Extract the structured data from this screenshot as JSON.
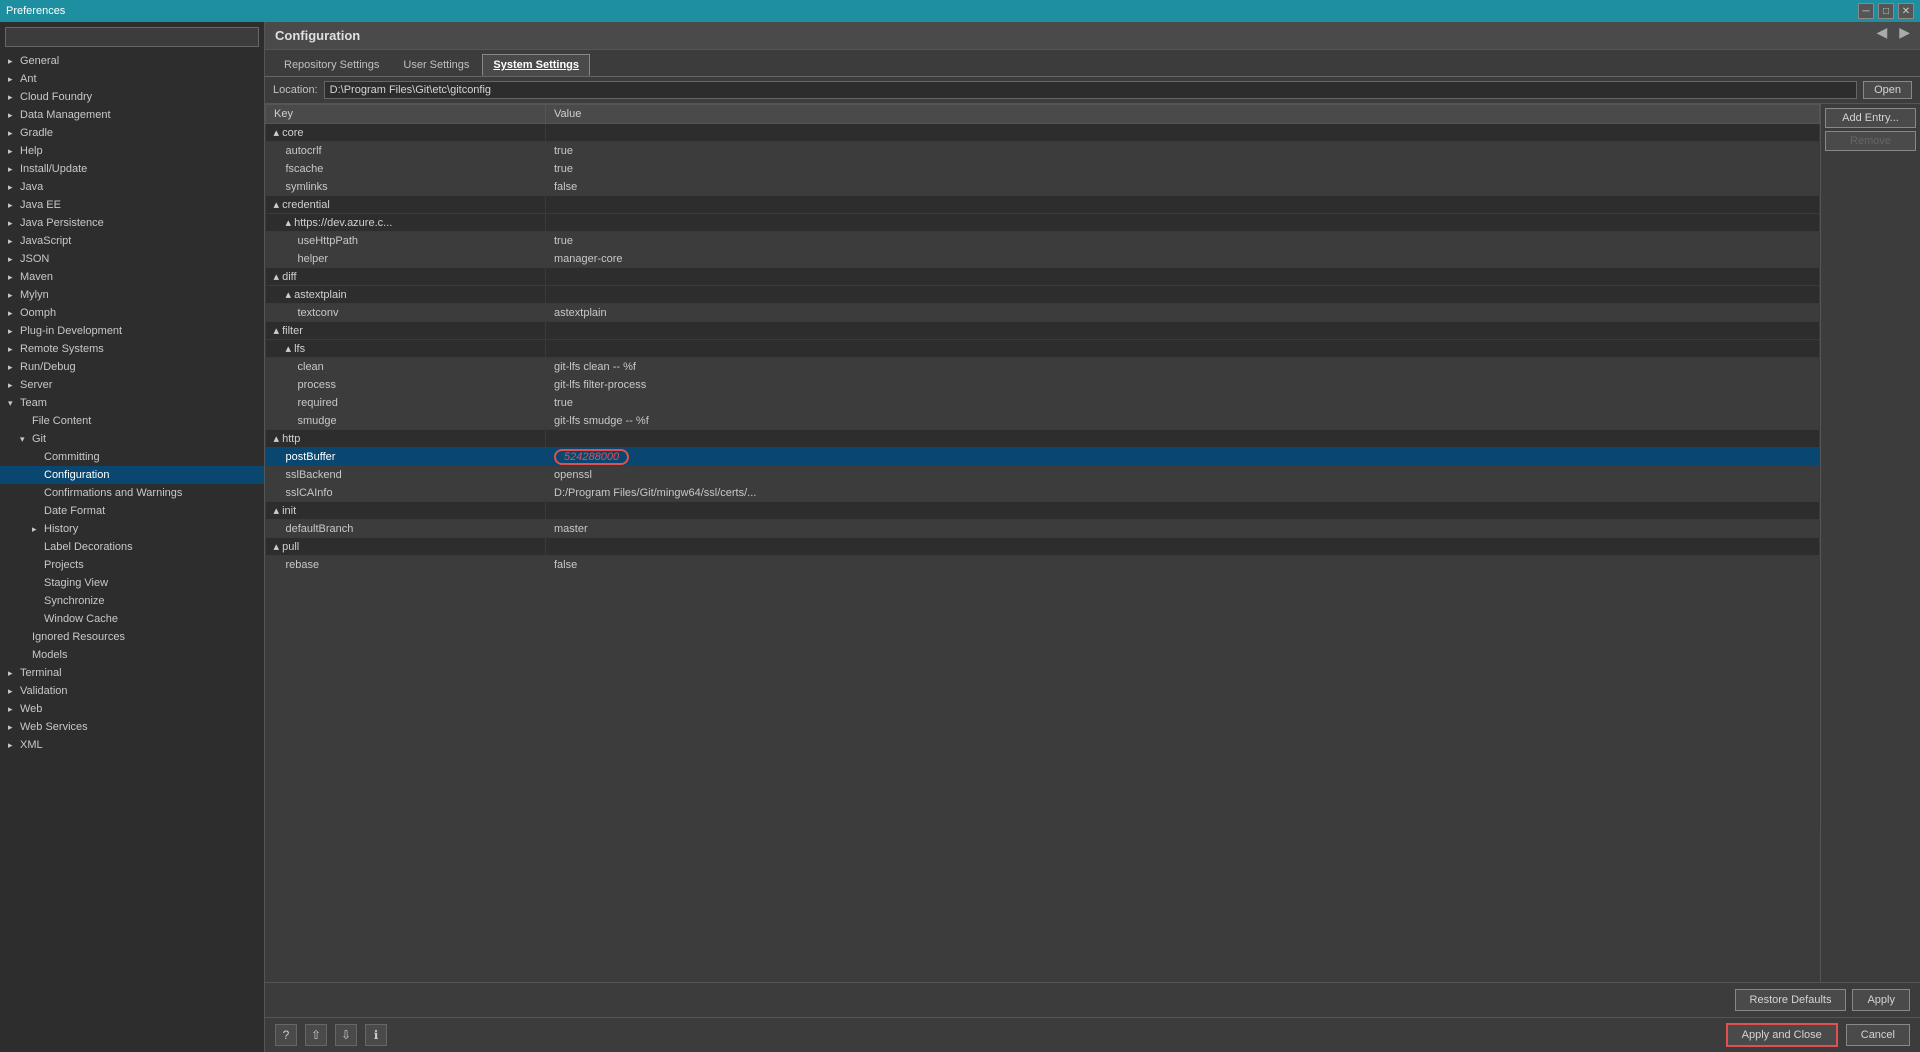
{
  "titleBar": {
    "title": "Preferences",
    "buttons": [
      "minimize",
      "maximize",
      "close"
    ]
  },
  "sidebar": {
    "searchPlaceholder": "",
    "items": [
      {
        "id": "general",
        "label": "General",
        "indent": 0,
        "expanded": false,
        "selected": false
      },
      {
        "id": "ant",
        "label": "Ant",
        "indent": 0,
        "expanded": false,
        "selected": false
      },
      {
        "id": "cloudFoundry",
        "label": "Cloud Foundry",
        "indent": 0,
        "expanded": false,
        "selected": false
      },
      {
        "id": "dataManagement",
        "label": "Data Management",
        "indent": 0,
        "expanded": false,
        "selected": false
      },
      {
        "id": "gradle",
        "label": "Gradle",
        "indent": 0,
        "expanded": false,
        "selected": false
      },
      {
        "id": "help",
        "label": "Help",
        "indent": 0,
        "expanded": false,
        "selected": false
      },
      {
        "id": "installUpdate",
        "label": "Install/Update",
        "indent": 0,
        "expanded": false,
        "selected": false
      },
      {
        "id": "java",
        "label": "Java",
        "indent": 0,
        "expanded": false,
        "selected": false
      },
      {
        "id": "javaEE",
        "label": "Java EE",
        "indent": 0,
        "expanded": false,
        "selected": false
      },
      {
        "id": "javaPersistence",
        "label": "Java Persistence",
        "indent": 0,
        "expanded": false,
        "selected": false
      },
      {
        "id": "javaScript",
        "label": "JavaScript",
        "indent": 0,
        "expanded": false,
        "selected": false
      },
      {
        "id": "json",
        "label": "JSON",
        "indent": 0,
        "expanded": false,
        "selected": false
      },
      {
        "id": "maven",
        "label": "Maven",
        "indent": 0,
        "expanded": false,
        "selected": false
      },
      {
        "id": "mylyn",
        "label": "Mylyn",
        "indent": 0,
        "expanded": false,
        "selected": false
      },
      {
        "id": "oomph",
        "label": "Oomph",
        "indent": 0,
        "expanded": false,
        "selected": false
      },
      {
        "id": "pluginDev",
        "label": "Plug-in Development",
        "indent": 0,
        "expanded": false,
        "selected": false
      },
      {
        "id": "remoteSystems",
        "label": "Remote Systems",
        "indent": 0,
        "expanded": false,
        "selected": false
      },
      {
        "id": "runDebug",
        "label": "Run/Debug",
        "indent": 0,
        "expanded": false,
        "selected": false
      },
      {
        "id": "server",
        "label": "Server",
        "indent": 0,
        "expanded": false,
        "selected": false
      },
      {
        "id": "team",
        "label": "Team",
        "indent": 0,
        "expanded": true,
        "selected": false
      },
      {
        "id": "fileContent",
        "label": "File Content",
        "indent": 1,
        "expanded": false,
        "selected": false
      },
      {
        "id": "git",
        "label": "Git",
        "indent": 1,
        "expanded": true,
        "selected": false
      },
      {
        "id": "committing",
        "label": "Committing",
        "indent": 2,
        "expanded": false,
        "selected": false
      },
      {
        "id": "configuration",
        "label": "Configuration",
        "indent": 2,
        "expanded": false,
        "selected": true
      },
      {
        "id": "confirmationsWarnings",
        "label": "Confirmations and Warnings",
        "indent": 2,
        "expanded": false,
        "selected": false
      },
      {
        "id": "dateFormat",
        "label": "Date Format",
        "indent": 2,
        "expanded": false,
        "selected": false
      },
      {
        "id": "history",
        "label": "History",
        "indent": 2,
        "expanded": false,
        "selected": false
      },
      {
        "id": "labelDecorations",
        "label": "Label Decorations",
        "indent": 2,
        "expanded": false,
        "selected": false
      },
      {
        "id": "projects",
        "label": "Projects",
        "indent": 2,
        "expanded": false,
        "selected": false
      },
      {
        "id": "stagingView",
        "label": "Staging View",
        "indent": 2,
        "expanded": false,
        "selected": false
      },
      {
        "id": "synchronize",
        "label": "Synchronize",
        "indent": 2,
        "expanded": false,
        "selected": false
      },
      {
        "id": "windowCache",
        "label": "Window Cache",
        "indent": 2,
        "expanded": false,
        "selected": false
      },
      {
        "id": "ignoredResources",
        "label": "Ignored Resources",
        "indent": 1,
        "expanded": false,
        "selected": false
      },
      {
        "id": "models",
        "label": "Models",
        "indent": 1,
        "expanded": false,
        "selected": false
      },
      {
        "id": "terminal",
        "label": "Terminal",
        "indent": 0,
        "expanded": false,
        "selected": false
      },
      {
        "id": "validation",
        "label": "Validation",
        "indent": 0,
        "expanded": false,
        "selected": false
      },
      {
        "id": "web",
        "label": "Web",
        "indent": 0,
        "expanded": false,
        "selected": false
      },
      {
        "id": "webServices",
        "label": "Web Services",
        "indent": 0,
        "expanded": false,
        "selected": false
      },
      {
        "id": "xml",
        "label": "XML",
        "indent": 0,
        "expanded": false,
        "selected": false
      }
    ]
  },
  "panel": {
    "title": "Configuration",
    "tabs": [
      {
        "id": "repositorySettings",
        "label": "Repository Settings",
        "active": false
      },
      {
        "id": "userSettings",
        "label": "User Settings",
        "active": false
      },
      {
        "id": "systemSettings",
        "label": "System Settings",
        "active": true
      }
    ],
    "locationLabel": "Location:",
    "locationValue": "D:\\Program Files\\Git\\etc\\gitconfig",
    "openBtn": "Open",
    "tableHeaders": [
      "Key",
      "Value"
    ],
    "tableRows": [
      {
        "type": "section",
        "key": "▴  core",
        "value": "",
        "indent": 0,
        "keyClass": "section-open"
      },
      {
        "type": "data",
        "key": "autocrlf",
        "value": "true",
        "indent": 1
      },
      {
        "type": "data",
        "key": "fscache",
        "value": "true",
        "indent": 1
      },
      {
        "type": "data",
        "key": "symlinks",
        "value": "false",
        "indent": 1
      },
      {
        "type": "section",
        "key": "▴  credential",
        "value": "",
        "indent": 0
      },
      {
        "type": "section",
        "key": "▴  https://dev.azure.c...",
        "value": "",
        "indent": 1
      },
      {
        "type": "data",
        "key": "useHttpPath",
        "value": "true",
        "indent": 2
      },
      {
        "type": "data",
        "key": "helper",
        "value": "manager-core",
        "indent": 2
      },
      {
        "type": "section",
        "key": "▴  diff",
        "value": "",
        "indent": 0
      },
      {
        "type": "section",
        "key": "▴  astextplain",
        "value": "",
        "indent": 1
      },
      {
        "type": "data",
        "key": "textconv",
        "value": "astextplain",
        "indent": 2
      },
      {
        "type": "section",
        "key": "▴  filter",
        "value": "",
        "indent": 0
      },
      {
        "type": "section",
        "key": "▴  lfs",
        "value": "",
        "indent": 1
      },
      {
        "type": "data",
        "key": "clean",
        "value": "git-lfs clean -- %f",
        "indent": 2
      },
      {
        "type": "data",
        "key": "process",
        "value": "git-lfs filter-process",
        "indent": 2
      },
      {
        "type": "data",
        "key": "required",
        "value": "true",
        "indent": 2
      },
      {
        "type": "data",
        "key": "smudge",
        "value": "git-lfs smudge -- %f",
        "indent": 2
      },
      {
        "type": "section",
        "key": "▴  http",
        "value": "",
        "indent": 0
      },
      {
        "type": "data",
        "key": "postBuffer",
        "value": "524288000",
        "indent": 1,
        "selected": true,
        "valueHighlight": true
      },
      {
        "type": "data",
        "key": "sslBackend",
        "value": "openssl",
        "indent": 1
      },
      {
        "type": "data",
        "key": "sslCAInfo",
        "value": "D:/Program Files/Git/mingw64/ssl/certs/...",
        "indent": 1
      },
      {
        "type": "section",
        "key": "▴  init",
        "value": "",
        "indent": 0
      },
      {
        "type": "data",
        "key": "defaultBranch",
        "value": "master",
        "indent": 1
      },
      {
        "type": "section",
        "key": "▴  pull",
        "value": "",
        "indent": 0
      },
      {
        "type": "data",
        "key": "rebase",
        "value": "false",
        "indent": 1
      },
      {
        "type": "empty"
      },
      {
        "type": "empty"
      },
      {
        "type": "empty"
      },
      {
        "type": "empty"
      },
      {
        "type": "empty"
      },
      {
        "type": "empty"
      },
      {
        "type": "empty"
      },
      {
        "type": "empty"
      },
      {
        "type": "empty"
      },
      {
        "type": "empty"
      },
      {
        "type": "empty"
      },
      {
        "type": "empty"
      },
      {
        "type": "empty"
      },
      {
        "type": "empty"
      }
    ],
    "addEntryBtn": "Add Entry...",
    "removeBtn": "Remove"
  },
  "bottomBar": {
    "restoreDefaultsBtn": "Restore Defaults",
    "applyBtn": "Apply"
  },
  "footer": {
    "applyAndCloseBtn": "Apply and Close",
    "cancelBtn": "Cancel"
  },
  "navArrows": {
    "back": "◀",
    "forward": "▶"
  }
}
